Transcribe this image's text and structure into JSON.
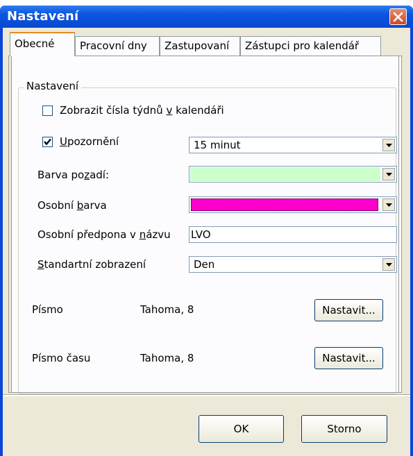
{
  "window": {
    "title": "Nastavení"
  },
  "tabs": [
    {
      "label": "Obecné",
      "active": true
    },
    {
      "label": "Pracovní dny",
      "active": false
    },
    {
      "label": "Zastupovaní",
      "active": false
    },
    {
      "label": "Zástupci pro kalendář",
      "active": false
    }
  ],
  "group": {
    "label": "Nastavení"
  },
  "options": {
    "week_numbers": {
      "label_pre": "Zobrazit čísla týdnů ",
      "label_key": "v",
      "label_post": " kalendáři",
      "checked": false
    },
    "reminder": {
      "label_key": "U",
      "label_post": "pozornění",
      "checked": true,
      "value": "15 minut"
    },
    "background_color": {
      "label_pre": "Barva po",
      "label_key": "z",
      "label_post": "adí:",
      "color": "#ccffcc"
    },
    "personal_color": {
      "label_pre": "Osobní ",
      "label_key": "b",
      "label_post": "arva",
      "color": "#ff00cc"
    },
    "prefix": {
      "label_pre": "Osobní předpona v ",
      "label_key": "n",
      "label_post": "ázvu",
      "value": "LVO"
    },
    "default_view": {
      "label_key": "S",
      "label_post": "tandartní zobrazení",
      "value": "Den"
    }
  },
  "fonts": [
    {
      "label": "Písmo",
      "value": "Tahoma, 8",
      "button": "Nastavit..."
    },
    {
      "label": "Písmo času",
      "value": "Tahoma, 8",
      "button": "Nastavit..."
    }
  ],
  "footer": {
    "ok": "OK",
    "cancel": "Storno"
  },
  "colors": {
    "titlebar": "#0a55e0",
    "close": "#c94a2b",
    "dialog_bg": "#ece9d8",
    "active_tab_accent": "#e68b2c"
  }
}
